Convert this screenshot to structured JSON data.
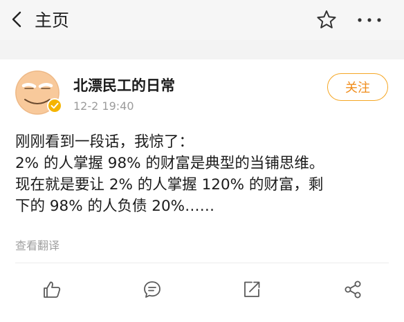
{
  "nav": {
    "back_label": "主页",
    "icons": {
      "back": "chevron-left-icon",
      "favorite": "star-icon",
      "more": "more-dots-icon"
    }
  },
  "post": {
    "author": {
      "name": "北漂民工的日常",
      "avatar": "smiley-face-avatar",
      "verified_badge": "verified-badge-icon"
    },
    "time": "12-2 19:40",
    "follow_label": "关注",
    "content_lines": [
      "刚刚看到一段话，我惊了：",
      "2% 的人掌握 98% 的财富是典型的当铺思维。",
      "现在就是要让 2% 的人掌握 120% 的财富，剩",
      "下的 98% 的人负债 20%……"
    ],
    "translate_label": "查看翻译",
    "actions": {
      "like": "thumbs-up-icon",
      "comment": "comment-icon",
      "repost": "repost-icon",
      "share": "share-icon"
    }
  },
  "colors": {
    "accent_orange": "#f5a623",
    "secondary_text": "#9b9b9b",
    "icon_gray": "#5a5a5a",
    "avatar_yellow": "#f8c99b"
  }
}
